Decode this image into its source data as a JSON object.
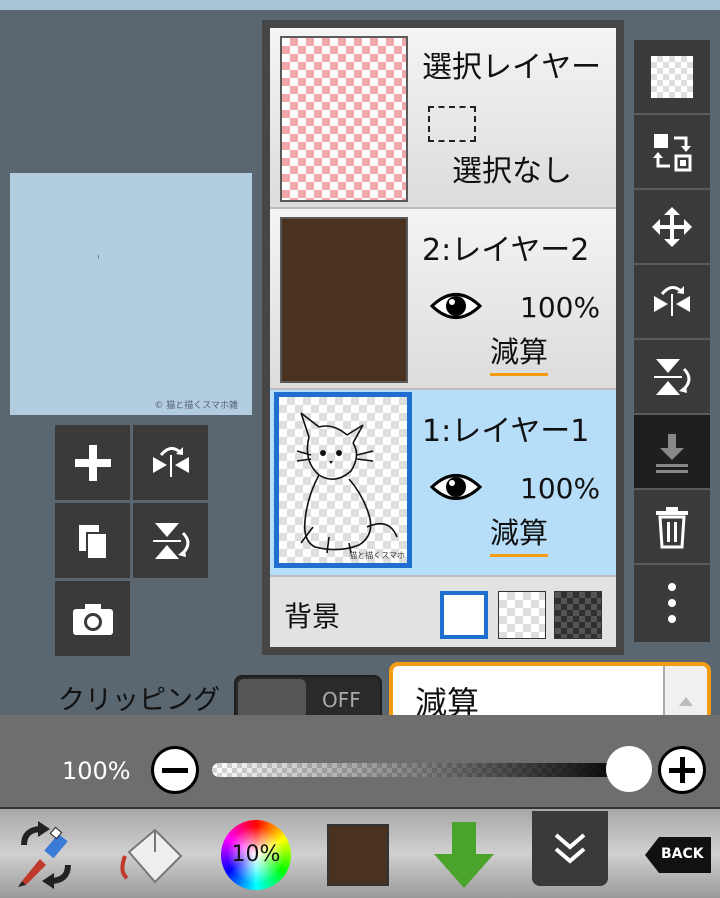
{
  "canvas": {
    "watermark": "© 猫と描くスマホ雑"
  },
  "layers": {
    "selection_layer": {
      "name": "選択レイヤー",
      "status": "選択なし"
    },
    "layer2": {
      "name": "2:レイヤー2",
      "opacity": "100%",
      "blend": "減算",
      "color": "#4a3220"
    },
    "layer1": {
      "name": "1:レイヤー1",
      "opacity": "100%",
      "blend": "減算",
      "watermark": "猫と描くスマホ"
    },
    "background": {
      "label": "背景"
    }
  },
  "clipping": {
    "label": "クリッピング",
    "toggle": "OFF"
  },
  "blend_mode": {
    "value": "減算"
  },
  "opacity_slider": {
    "value_text": "100%",
    "value": 1.0
  },
  "bottom_bar": {
    "color_wheel_label": "10%",
    "back_label": "BACK",
    "current_color": "#4a3220"
  },
  "icons": {
    "left_tools": [
      "plus-icon",
      "flip-horizontal-icon",
      "copy-icon",
      "flip-vertical-icon",
      "camera-icon"
    ],
    "right_tools": [
      "transparency-icon",
      "swap-layer-icon",
      "move-icon",
      "flip-horizontal-icon",
      "flip-vertical-icon",
      "merge-down-icon",
      "trash-icon",
      "more-icon"
    ]
  },
  "colors": {
    "accent": "#f39c12",
    "selected_layer": "#b6def8",
    "selected_border": "#1e6fd0"
  }
}
